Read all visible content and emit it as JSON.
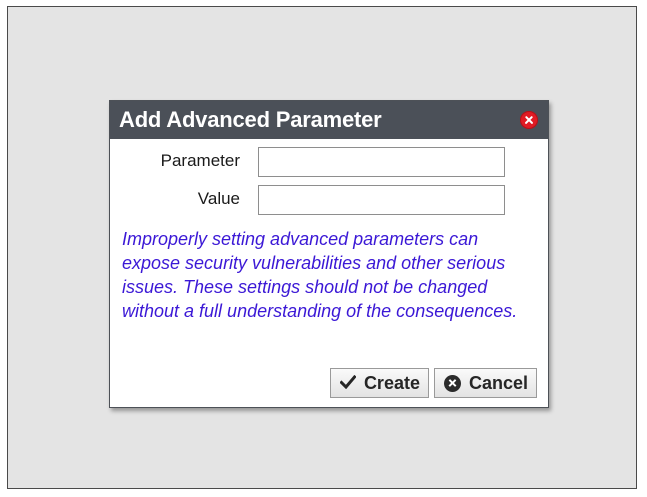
{
  "dialog": {
    "title": "Add Advanced Parameter",
    "close_icon": "close-circle-icon",
    "fields": {
      "parameter": {
        "label": "Parameter",
        "value": "",
        "placeholder": ""
      },
      "value": {
        "label": "Value",
        "value": "",
        "placeholder": ""
      }
    },
    "warning": "Improperly setting advanced parameters can expose security vulnerabilities and other serious issues. These settings should not be changed without a full understanding of the consequences.",
    "buttons": {
      "create": {
        "label": "Create",
        "icon": "check-icon"
      },
      "cancel": {
        "label": "Cancel",
        "icon": "cancel-circle-icon"
      }
    }
  },
  "colors": {
    "background": "#e4e4e4",
    "titlebar": "#4b5058",
    "close": "#e01b24",
    "warning_text": "#3b18d6"
  }
}
